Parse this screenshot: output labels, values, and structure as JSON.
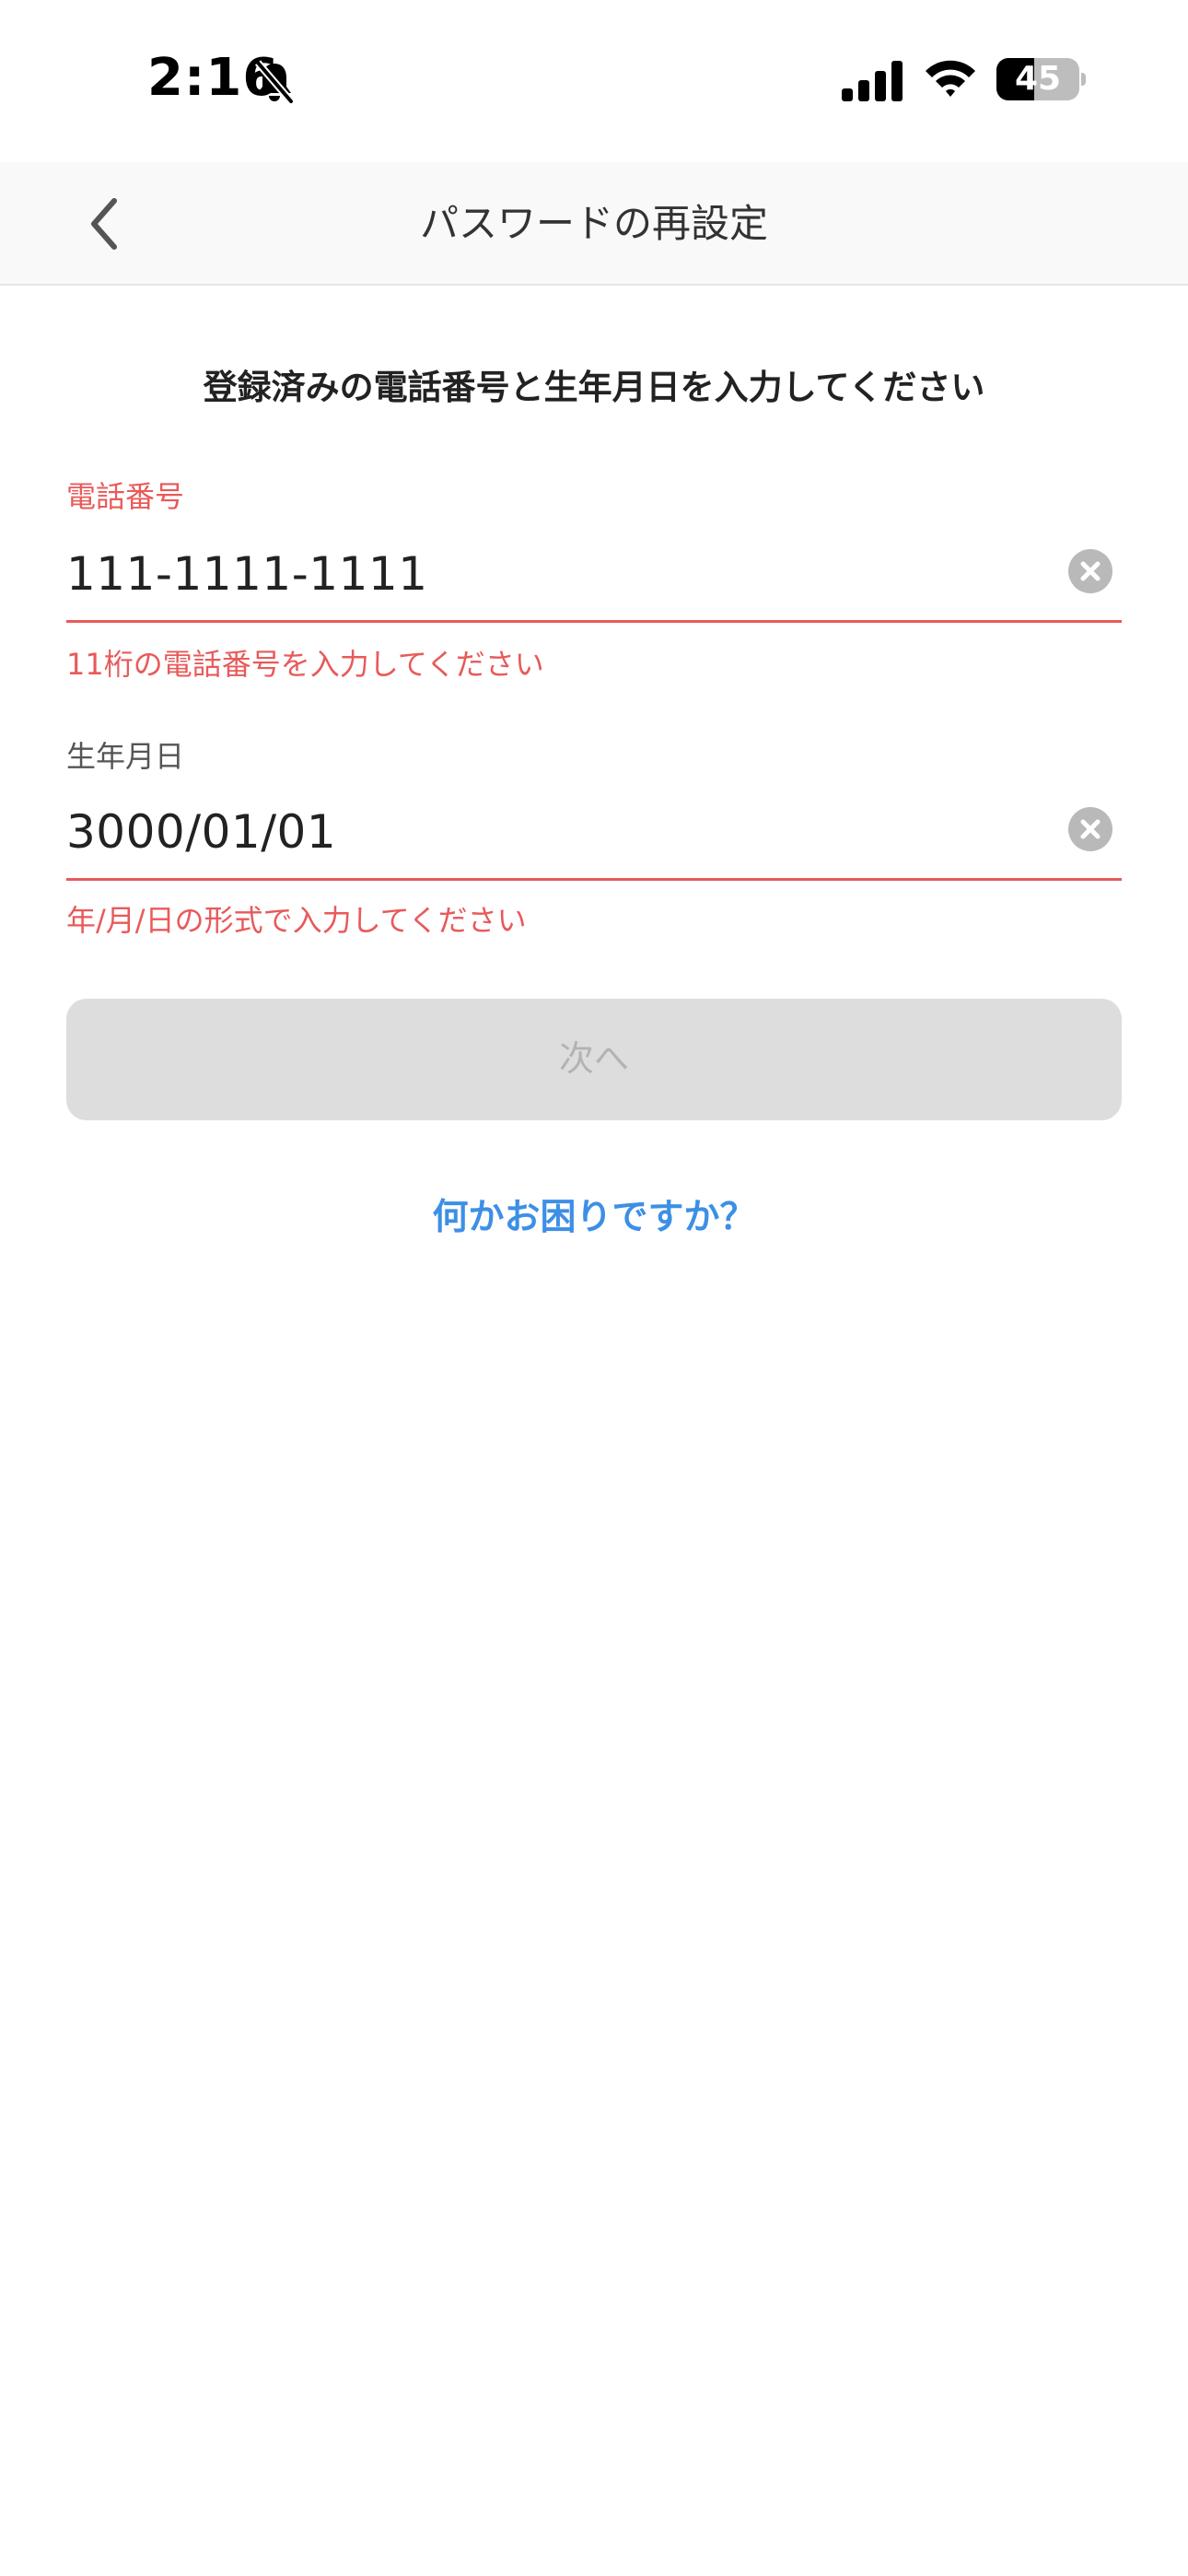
{
  "status_bar": {
    "time": "2:16",
    "battery_level": "45",
    "battery_fraction": 0.45
  },
  "nav": {
    "title": "パスワードの再設定",
    "back_icon": "chevron-left-icon"
  },
  "form": {
    "instruction": "登録済みの電話番号と生年月日を入力してください",
    "phone": {
      "label": "電話番号",
      "value": "111-1111-1111",
      "error": "11桁の電話番号を入力してください"
    },
    "birthdate": {
      "label": "生年月日",
      "value": "3000/01/01",
      "error": "年/月/日の形式で入力してください"
    },
    "next_label": "次へ",
    "help_label": "何かお困りですか？"
  },
  "colors": {
    "error": "#e85a5a",
    "link": "#3d8fe6",
    "disabled_button": "#dddddd",
    "disabled_text": "#b3b3b3"
  }
}
